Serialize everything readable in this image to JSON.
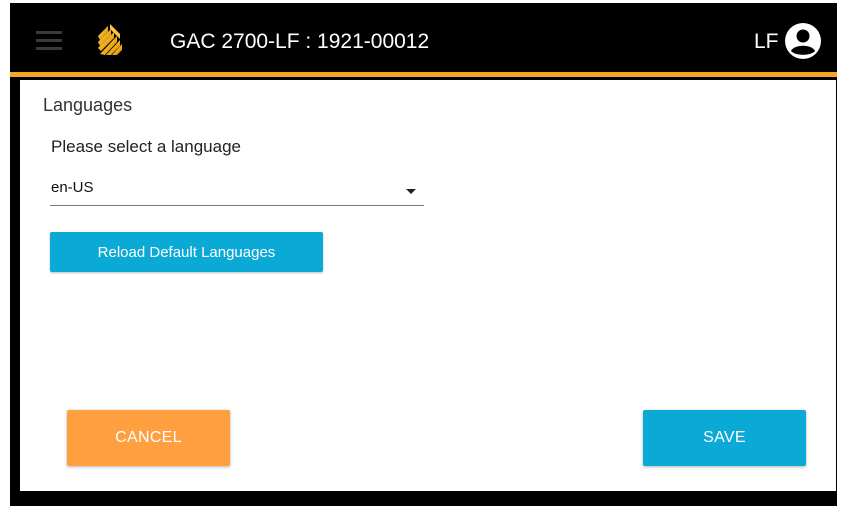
{
  "header": {
    "title": "GAC 2700-LF : 1921-00012",
    "user_initials": "LF",
    "menu_icon": "hamburger-menu-icon",
    "logo_icon": "company-logo",
    "user_icon": "account-circle-icon",
    "accent_color": "#f5a623"
  },
  "main": {
    "section_title": "Languages",
    "prompt": "Please select a language",
    "language_select": {
      "value": "en-US"
    },
    "reload_button_label": "Reload Default Languages"
  },
  "footer": {
    "cancel_label": "CANCEL",
    "save_label": "SAVE",
    "cancel_color": "#ff9f40",
    "save_color": "#0aa9d6"
  }
}
